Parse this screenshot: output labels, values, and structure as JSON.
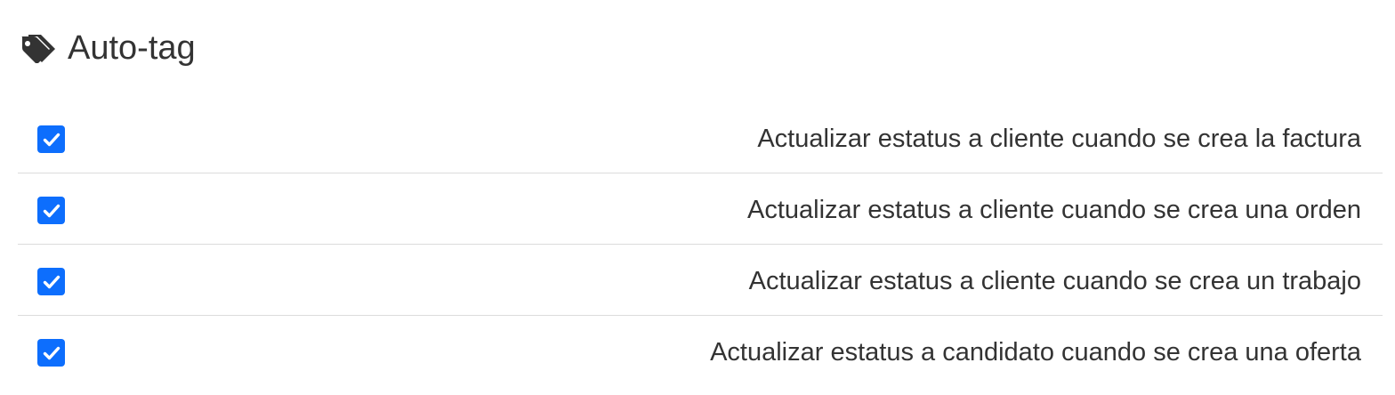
{
  "header": {
    "icon": "tags-icon",
    "title": "Auto-tag"
  },
  "accent_color": "#0d6efd",
  "rules": [
    {
      "checked": true,
      "label": "Actualizar estatus a cliente cuando se crea la factura"
    },
    {
      "checked": true,
      "label": "Actualizar estatus a cliente cuando se crea una orden"
    },
    {
      "checked": true,
      "label": "Actualizar estatus a cliente cuando se crea un trabajo"
    },
    {
      "checked": true,
      "label": "Actualizar estatus a candidato cuando se crea una oferta"
    }
  ]
}
